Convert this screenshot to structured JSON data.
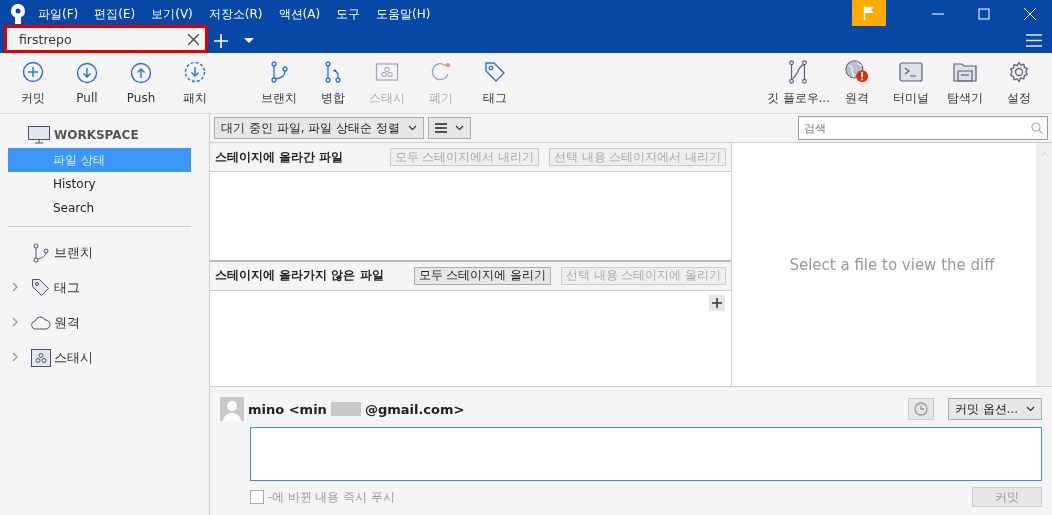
{
  "menu": [
    "파일(F)",
    "편집(E)",
    "보기(V)",
    "저장소(R)",
    "액션(A)",
    "도구",
    "도움말(H)"
  ],
  "tabs": [
    {
      "label": "firstrepo",
      "selected": true
    }
  ],
  "toolbar_left": [
    {
      "kind": "commit",
      "label": "커밋",
      "disabled": false
    },
    {
      "kind": "pull",
      "label": "Pull",
      "disabled": false
    },
    {
      "kind": "push",
      "label": "Push",
      "disabled": false
    },
    {
      "kind": "fetch",
      "label": "패치",
      "disabled": false
    },
    {
      "kind": "branch",
      "label": "브랜치",
      "disabled": false
    },
    {
      "kind": "merge",
      "label": "병합",
      "disabled": false
    },
    {
      "kind": "stash",
      "label": "스태시",
      "disabled": true
    },
    {
      "kind": "discard",
      "label": "폐기",
      "disabled": true
    },
    {
      "kind": "tag",
      "label": "태그",
      "disabled": false
    }
  ],
  "toolbar_right": [
    {
      "kind": "gitflow",
      "label": "깃 플로우...",
      "disabled": false
    },
    {
      "kind": "remote",
      "label": "원격",
      "disabled": false
    },
    {
      "kind": "terminal",
      "label": "터미널",
      "disabled": false
    },
    {
      "kind": "explorer",
      "label": "탐색기",
      "disabled": false
    },
    {
      "kind": "settings",
      "label": "설정",
      "disabled": false
    }
  ],
  "sidebar": {
    "workspace": "WORKSPACE",
    "items": [
      {
        "label": "파일 상태",
        "selected": true
      },
      {
        "label": "History",
        "selected": false
      },
      {
        "label": "Search",
        "selected": false
      }
    ],
    "sections": [
      {
        "kind": "branch",
        "label": "브랜치",
        "expandable": false
      },
      {
        "kind": "tag",
        "label": "태그",
        "expandable": true
      },
      {
        "kind": "remote",
        "label": "원격",
        "expandable": true
      },
      {
        "kind": "stash",
        "label": "스태시",
        "expandable": true
      }
    ]
  },
  "filter": {
    "sort": "대기 중인 파일, 파일 상태순 정렬",
    "search_placeholder": "검색"
  },
  "staged": {
    "title": "스테이지에 올라간 파일",
    "buttons": [
      {
        "label": "모두 스테이지에서 내리기",
        "disabled": true
      },
      {
        "label": "선택 내용 스테이지에서 내리기",
        "disabled": true
      }
    ]
  },
  "unstaged": {
    "title": "스테이지에 올라가지 않은 파일",
    "buttons": [
      {
        "label": "모두 스테이지에 올리기",
        "disabled": false
      },
      {
        "label": "선택 내용 스테이지에 올리기",
        "disabled": true
      }
    ]
  },
  "diff": {
    "message": "Select a file to view the diff"
  },
  "commit": {
    "author_start": "mino <min",
    "author_end": "@gmail.com>",
    "options": "커밋 옵션...",
    "push_label": "-에 바뀐 내용 즉시 푸시",
    "push_checked": false,
    "button": "커밋"
  }
}
